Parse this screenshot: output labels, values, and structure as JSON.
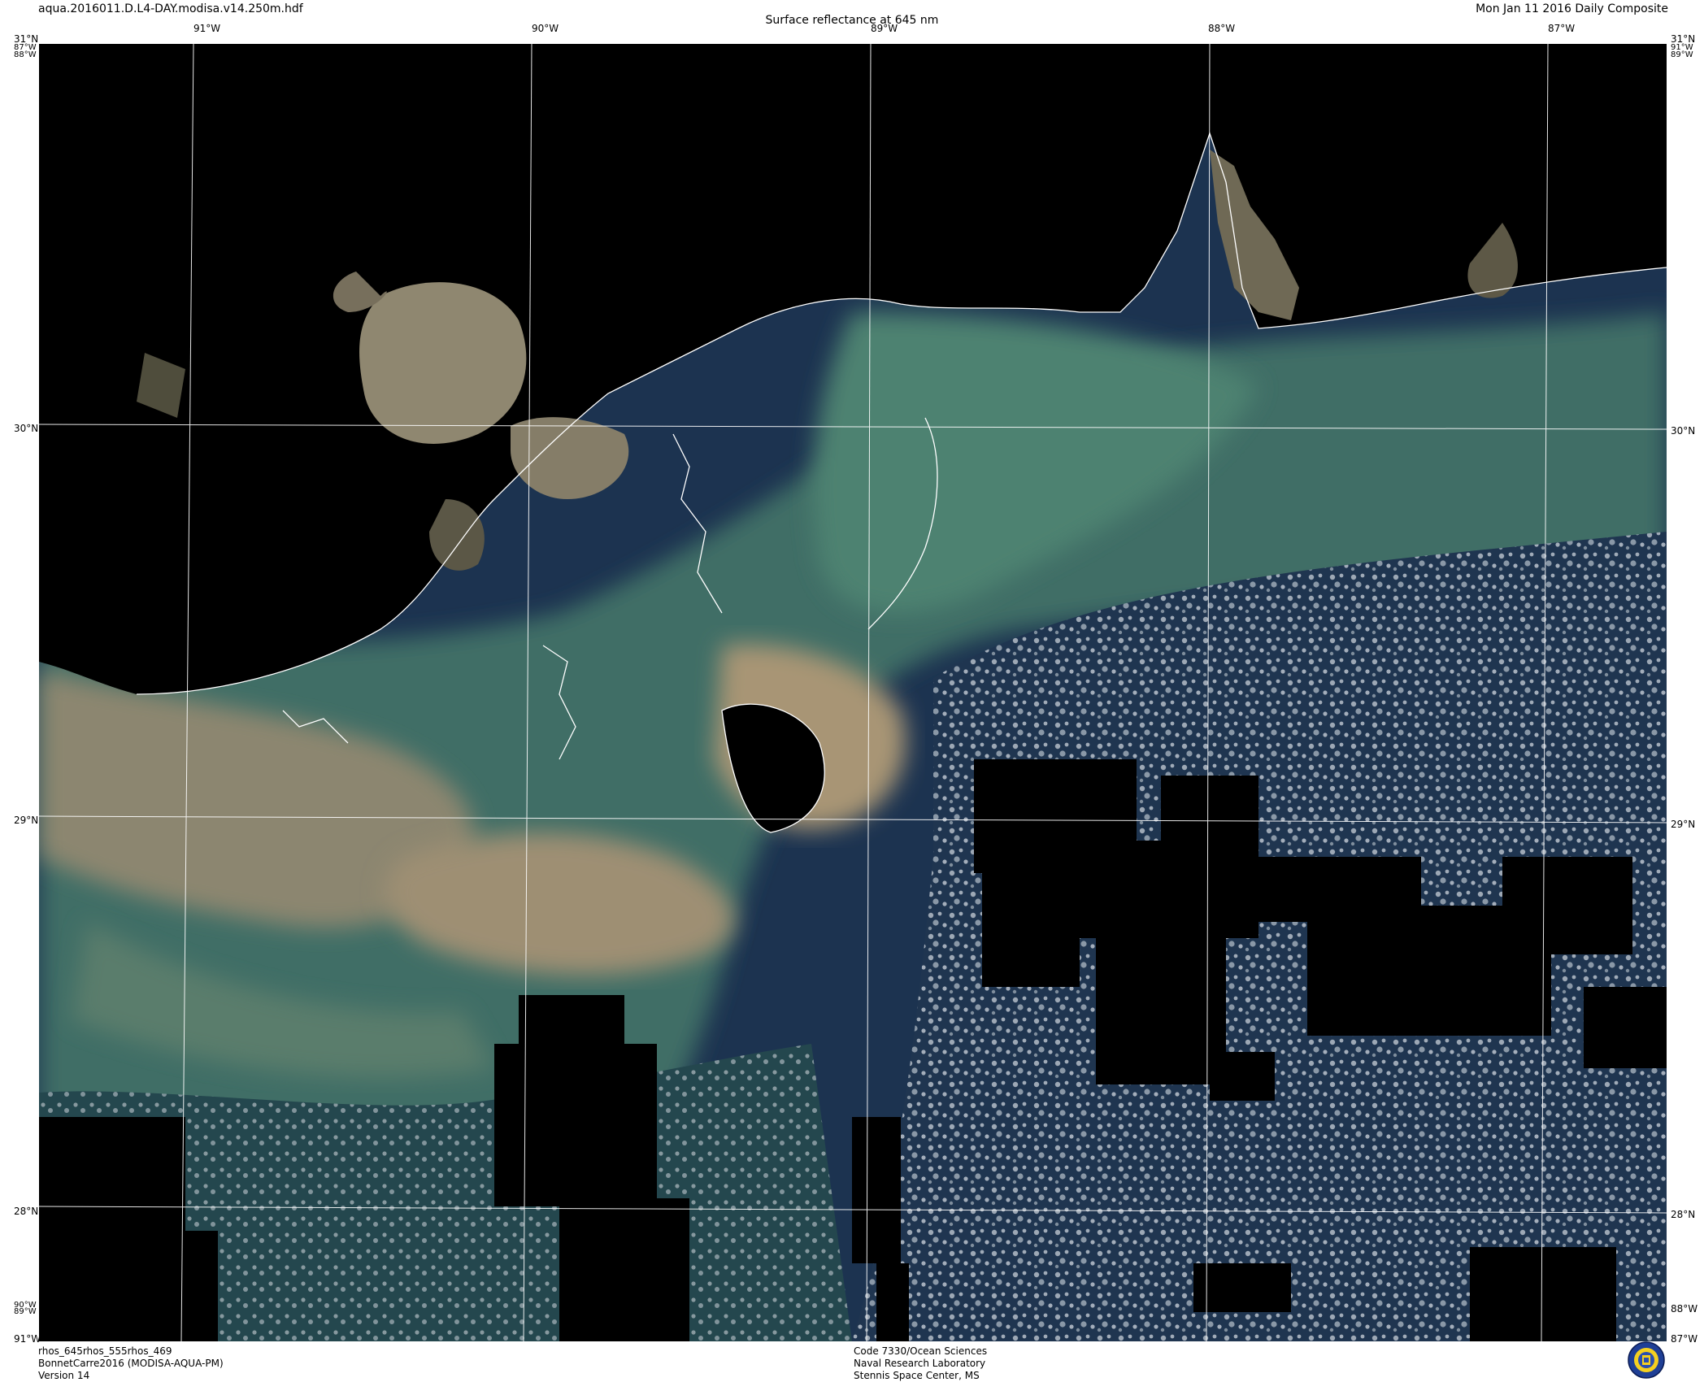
{
  "header": {
    "file_name": "aqua.2016011.D.L4-DAY.modisa.v14.250m.hdf",
    "product_title": "Surface reflectance at 645 nm",
    "date_label": "Mon Jan 11 2016 Daily Composite"
  },
  "map": {
    "top_lon_labels": [
      "91°W",
      "90°W",
      "89°W",
      "88°W",
      "87°W"
    ],
    "lat_labels": [
      "30°N",
      "29°N",
      "28°N"
    ],
    "corner_labels": {
      "top_left_lat": "31°N",
      "top_left_lon": "87°W",
      "top_left_lon2": "88°W",
      "top_right_lat": "31°N",
      "top_right_lon": "91°W",
      "top_right_lon2": "89°W",
      "bottom_left_lon": "90°W",
      "bottom_left_lon2": "89°W",
      "bottom_left_lon3": "91°W",
      "bottom_right_lon": "88°W",
      "bottom_right_lon2": "87°W"
    },
    "colors": {
      "land": "#000000",
      "sediment_plume": "#9b8a6e",
      "turbid_green_water": "#4d7a68",
      "open_gulf_water": "#233d56",
      "cloud": "#c9d0d6",
      "graticule": "#ffffff",
      "coastline": "#ffffff"
    }
  },
  "footer": {
    "bands": "rhos_645rhos_555rhos_469",
    "campaign": "BonnetCarre2016 (MODISA-AQUA-PM)",
    "version": "Version 14",
    "credit_line1": "Code 7330/Ocean Sciences",
    "credit_line2": "Naval Research Laboratory",
    "credit_line3": "Stennis Space Center, MS"
  },
  "seal": {
    "icon": "nrl-seal-icon"
  }
}
